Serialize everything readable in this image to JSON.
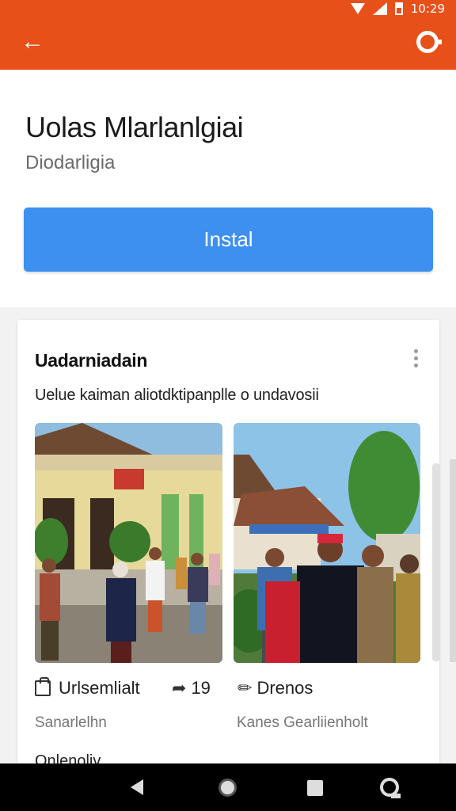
{
  "status_bar": {
    "time": "10:29"
  },
  "app_header": {
    "title": "Uolas Mlarlanlgiai",
    "subtitle": "Diodarligia",
    "install_label": "Instal"
  },
  "card": {
    "title": "Uadarniadain",
    "description": "Uelue kaiman aliotdktipanplle o undavosii",
    "photos": [
      {
        "alt": "Group of people standing in front of a building with a red sign"
      },
      {
        "alt": "Men talking outdoors near houses with a red cap"
      }
    ],
    "meta": {
      "item1_label": "Urlsemlialt",
      "item1_count": "19",
      "item2_label": "Drenos",
      "sub1": "Sanarlelhn",
      "sub2": "Kanes Gearliienholt"
    },
    "footer": "Onlenoliv"
  },
  "colors": {
    "accent": "#e8501a",
    "button": "#3d8ff0"
  }
}
